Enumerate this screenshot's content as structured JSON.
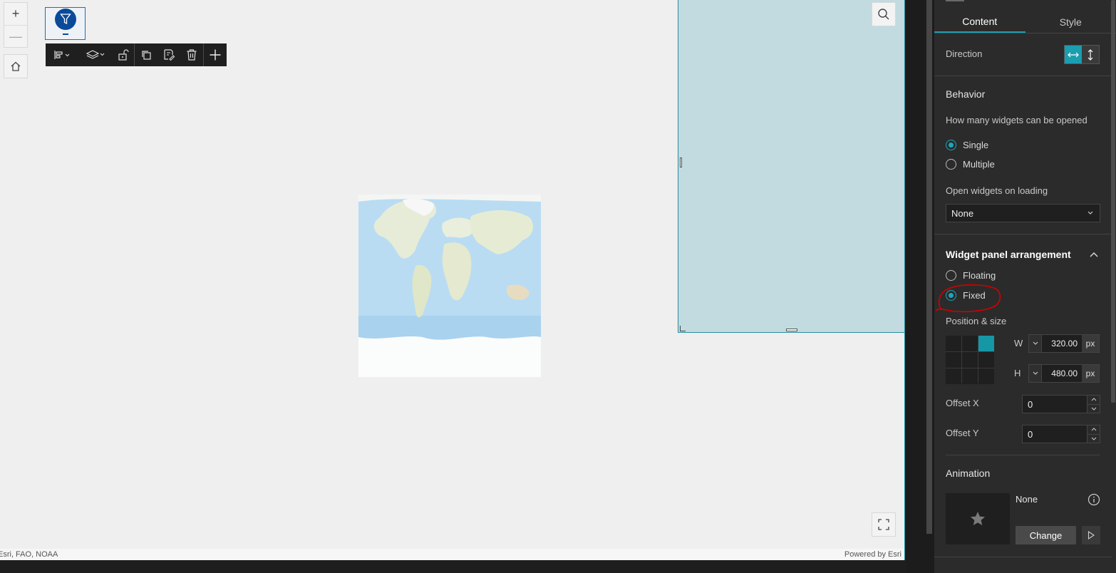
{
  "canvas": {
    "zoom_in": "+",
    "zoom_out": "—",
    "attribution_left": "Esri, FAO, NOAA",
    "attribution_right": "Powered by Esri"
  },
  "toolbar": {
    "items": [
      "align-icon",
      "layers-icon",
      "unlock-icon",
      "duplicate-icon",
      "copy-style-icon",
      "delete-icon",
      "add-icon"
    ]
  },
  "panel": {
    "tabs": [
      {
        "label": "Content",
        "active": true
      },
      {
        "label": "Style",
        "active": false
      }
    ],
    "direction_label": "Direction",
    "behavior_title": "Behavior",
    "behavior_question": "How many widgets can be opened",
    "behavior_options": [
      {
        "label": "Single",
        "checked": true
      },
      {
        "label": "Multiple",
        "checked": false
      }
    ],
    "open_on_loading_label": "Open widgets on loading",
    "open_on_loading_value": "None",
    "arrangement_title": "Widget panel arrangement",
    "arrangement_options": [
      {
        "label": "Floating",
        "checked": false
      },
      {
        "label": "Fixed",
        "checked": true
      }
    ],
    "position_size_label": "Position & size",
    "width": {
      "label": "W",
      "value": "320.00",
      "unit": "px"
    },
    "height": {
      "label": "H",
      "value": "480.00",
      "unit": "px"
    },
    "offset_x": {
      "label": "Offset X",
      "value": "0"
    },
    "offset_y": {
      "label": "Offset Y",
      "value": "0"
    },
    "animation_title": "Animation",
    "animation_value": "None",
    "change_label": "Change"
  },
  "colors": {
    "accent": "#1a9eb0",
    "panel_bg": "#2b2b2b",
    "canvas_bg": "#efefef",
    "widget_panel_bg": "#c2dbe0",
    "annotation": "#d40000"
  }
}
